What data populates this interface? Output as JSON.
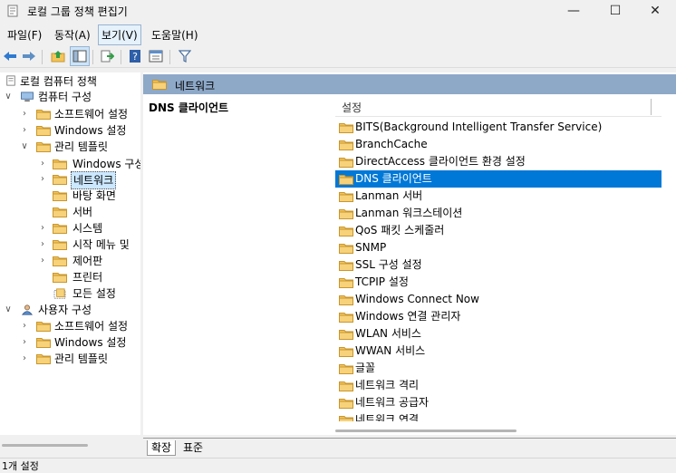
{
  "window": {
    "title": "로컬 그룹 정책 편집기",
    "minimize_symbol": "—",
    "maximize_symbol": "☐",
    "close_symbol": "✕"
  },
  "menu": {
    "items": [
      "파일(F)",
      "동작(A)",
      "보기(V)",
      "도움말(H)"
    ]
  },
  "toolbar": {
    "icons": [
      "back-arrow-icon",
      "forward-arrow-icon",
      "up-folder-icon",
      "show-hide-tree-icon",
      "export-list-icon",
      "help-icon",
      "properties-icon",
      "filter-icon"
    ]
  },
  "tree": {
    "root": "로컬 컴퓨터 정책",
    "computer_config": "컴퓨터 구성",
    "software_settings": "소프트웨어 설정",
    "windows_settings": "Windows 설정",
    "admin_templates": "관리 템플릿",
    "windows_components": "Windows 구성",
    "network": "네트워크",
    "desktop": "바탕 화면",
    "server": "서버",
    "system": "시스템",
    "start_menu": "시작 메뉴 및",
    "control_panel": "제어판",
    "printers": "프린터",
    "all_settings": "모든 설정",
    "user_config": "사용자 구성",
    "u_software_settings": "소프트웨어 설정",
    "u_windows_settings": "Windows 설정",
    "u_admin_templates": "관리 템플릿"
  },
  "right_pane": {
    "header": "네트워크",
    "description_title": "DNS 클라이언트",
    "column_header": "설정",
    "items": [
      "BITS(Background Intelligent Transfer Service)",
      "BranchCache",
      "DirectAccess 클라이언트 환경 설정",
      "DNS 클라이언트",
      "Lanman 서버",
      "Lanman 워크스테이션",
      "QoS 패킷 스케줄러",
      "SNMP",
      "SSL 구성 설정",
      "TCPIP 설정",
      "Windows Connect Now",
      "Windows 연결 관리자",
      "WLAN 서비스",
      "WWAN 서비스",
      "글꼴",
      "네트워크 격리",
      "네트워크 공급자",
      "네트워크 연결"
    ],
    "selected_index": 3
  },
  "tabs": {
    "extended": "확장",
    "standard": "표준"
  },
  "status": {
    "text": "1개 설정"
  },
  "colors": {
    "selection": "#0078d7",
    "header_band": "#8ea9c8",
    "folder": "#f3c45b"
  }
}
